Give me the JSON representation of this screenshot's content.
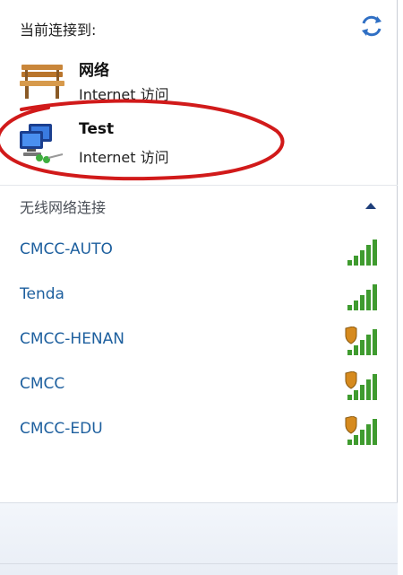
{
  "header": {
    "title": "当前连接到:"
  },
  "current_connections": [
    {
      "name": "网络",
      "status": "Internet 访问",
      "icon": "bench-icon"
    },
    {
      "name": "Test",
      "status": "Internet 访问",
      "icon": "computer-network-icon"
    }
  ],
  "wireless": {
    "section_title": "无线网络连接",
    "networks": [
      {
        "name": "CMCC-AUTO",
        "secured": false,
        "signal_bars": 5
      },
      {
        "name": "Tenda",
        "secured": false,
        "signal_bars": 5
      },
      {
        "name": "CMCC-HENAN",
        "secured": true,
        "signal_bars": 5
      },
      {
        "name": "CMCC",
        "secured": true,
        "signal_bars": 5
      },
      {
        "name": "CMCC-EDU",
        "secured": true,
        "signal_bars": 5
      }
    ]
  },
  "colors": {
    "link_blue": "#1d5f9e",
    "signal_green": "#3f9b2f",
    "annotation_red": "#d11a1a"
  }
}
